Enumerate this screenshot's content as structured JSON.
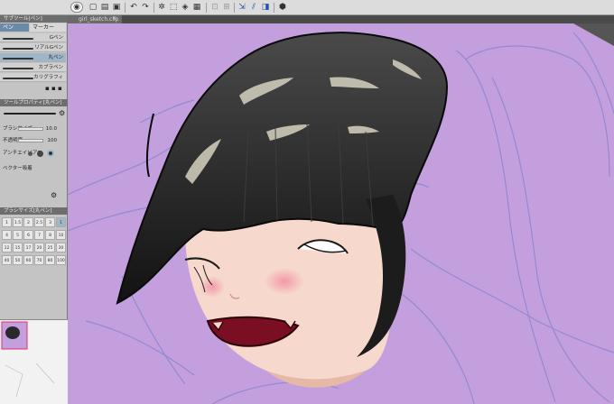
{
  "document": {
    "tab_title": "girl_sketch.clip"
  },
  "toolbar": {
    "icons": [
      "new-file-icon",
      "open-file-icon",
      "save-icon",
      "undo-icon",
      "redo-icon",
      "clear-icon",
      "transform-icon",
      "fill-icon",
      "deselect-icon",
      "crop-icon",
      "snap-icon",
      "ruler-icon",
      "symmetry-icon",
      "color-icon"
    ]
  },
  "left_panel": {
    "tool_tab": "サブツール[ペン]",
    "subtabs": [
      "ペン",
      "マーカー"
    ],
    "brushes": [
      {
        "label": "Gペン"
      },
      {
        "label": "リアルGペン"
      },
      {
        "label": "丸ペン"
      },
      {
        "label": "カブラペン"
      },
      {
        "label": "カリグラフィ"
      }
    ],
    "tool_property_tab": "ツールプロパティ[丸ペン]",
    "properties": [
      {
        "label": "ブラシサイズ",
        "value": "10.0"
      },
      {
        "label": "不透明度",
        "value": "100"
      },
      {
        "label": "アンチエイリアス",
        "value": ""
      },
      {
        "label": "ベクター吸着",
        "value": ""
      }
    ],
    "brush_size_tab": "ブラシサイズ[丸ペン]",
    "brush_sizes": [
      "1",
      "1.5",
      "2",
      "2.5",
      "3",
      "1",
      "4",
      "5",
      "6",
      "7",
      "8",
      "10",
      "12",
      "15",
      "17",
      "20",
      "25",
      "30",
      "40",
      "50",
      "60",
      "70",
      "80",
      "100"
    ]
  },
  "colors": {
    "canvas_bg": "#c3a0dd",
    "hair": "#1e1e1e",
    "skin": "#f6d8cc",
    "mouth": "#7a0e22",
    "sketch_line": "#8a86d0"
  }
}
